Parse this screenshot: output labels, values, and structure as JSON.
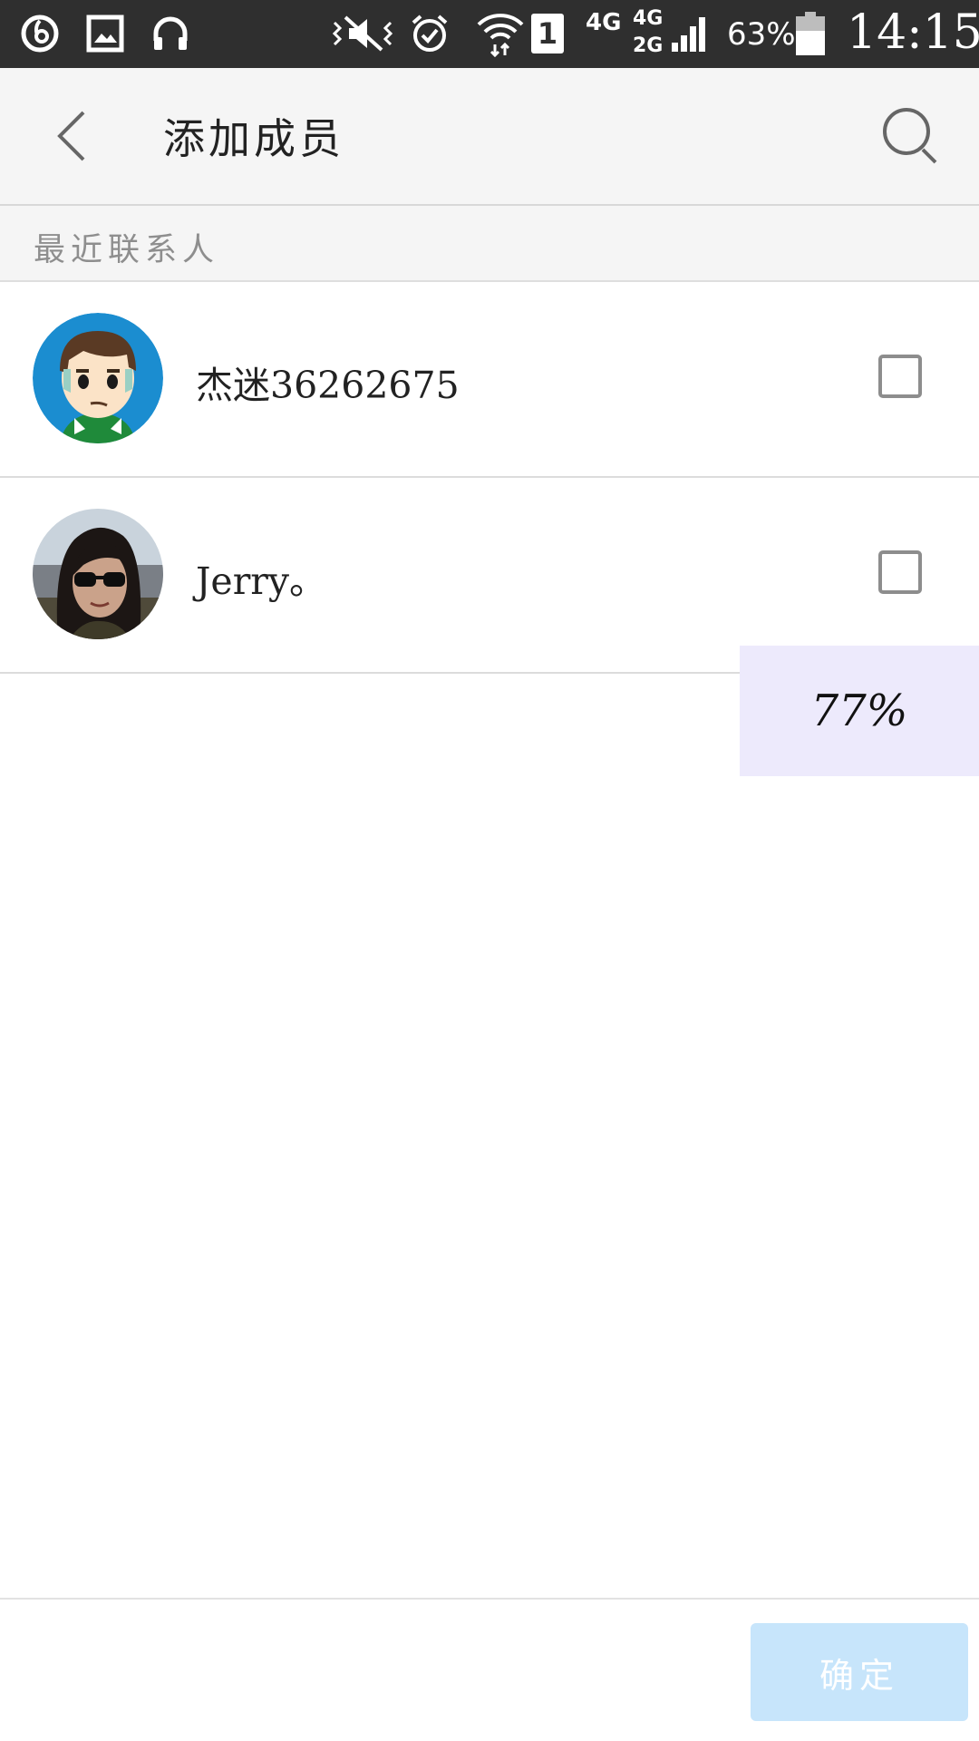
{
  "status_bar": {
    "icons": [
      "netease-music-icon",
      "gallery-icon",
      "headphones-icon",
      "vibrate-mute-icon",
      "alarm-icon",
      "wifi-icon",
      "sim-1-icon",
      "signal-icon",
      "battery-icon"
    ],
    "network_1": "4G",
    "network_2_top": "4G",
    "network_2_bottom": "2G",
    "sim_number": "1",
    "battery_percent": "63%",
    "battery_level": 0.63,
    "time": "14:15"
  },
  "header": {
    "title": "添加成员",
    "back_icon": "chevron-left-icon",
    "search_icon": "search-icon"
  },
  "section": {
    "label": "最近联系人"
  },
  "contacts": [
    {
      "name": "杰迷36262675",
      "avatar": "cartoon-boy-avatar",
      "checked": false
    },
    {
      "name": "Jerry。",
      "avatar": "photo-girl-sunglasses-avatar",
      "checked": false
    }
  ],
  "overlay": {
    "progress_text": "77%",
    "progress_value": 0.77
  },
  "footer": {
    "confirm_label": "确定"
  },
  "colors": {
    "status_bar_bg": "#2f2f2f",
    "title_bar_bg": "#f5f5f5",
    "confirm_button_bg": "#c7e5fb",
    "overlay_bg": "#edeafc"
  }
}
